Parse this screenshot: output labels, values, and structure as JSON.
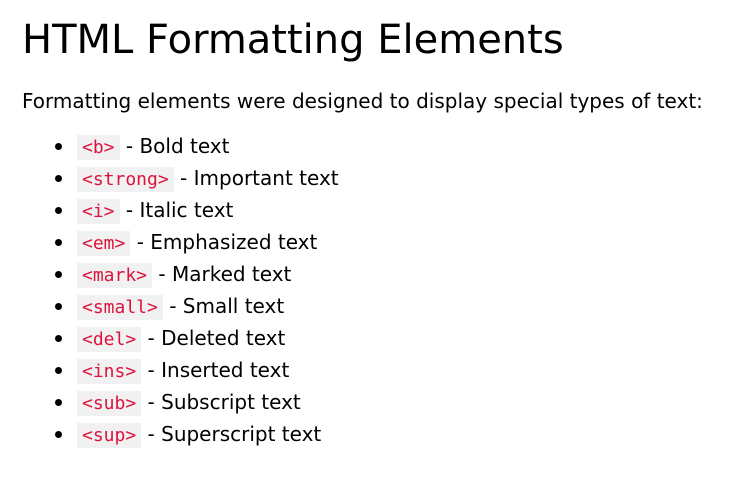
{
  "heading": "HTML Formatting Elements",
  "intro": "Formatting elements were designed to display special types of text:",
  "colors": {
    "code_text": "#dc143c",
    "code_background": "#f1f1f1"
  },
  "items": [
    {
      "tag": "<b>",
      "desc": " - Bold text"
    },
    {
      "tag": "<strong>",
      "desc": " - Important text"
    },
    {
      "tag": "<i>",
      "desc": " - Italic text"
    },
    {
      "tag": "<em>",
      "desc": " - Emphasized text"
    },
    {
      "tag": "<mark>",
      "desc": " - Marked text"
    },
    {
      "tag": "<small>",
      "desc": " - Small text"
    },
    {
      "tag": "<del>",
      "desc": " - Deleted text"
    },
    {
      "tag": "<ins>",
      "desc": " - Inserted text"
    },
    {
      "tag": "<sub>",
      "desc": " - Subscript text"
    },
    {
      "tag": "<sup>",
      "desc": " - Superscript text"
    }
  ]
}
